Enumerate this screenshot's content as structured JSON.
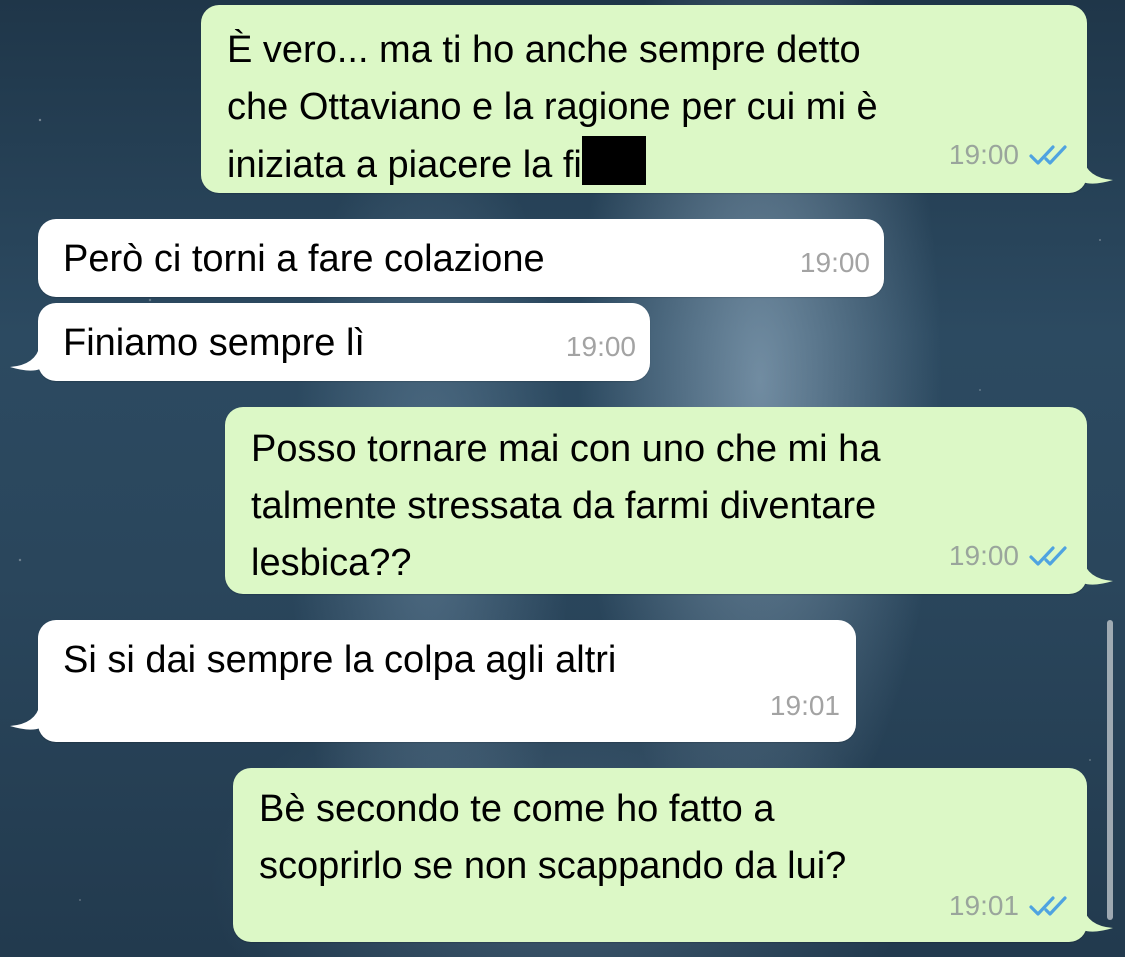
{
  "messages": [
    {
      "direction": "outgoing",
      "lines": [
        "È vero... ma ti ho anche sempre detto",
        "che Ottaviano e la ragione per cui mi è",
        "iniziata a piacere la fi"
      ],
      "time": "19:00",
      "status_icon": "double-check-read-icon"
    },
    {
      "direction": "incoming",
      "lines": [
        "Però ci torni a fare colazione"
      ],
      "time": "19:00"
    },
    {
      "direction": "incoming",
      "lines": [
        "Finiamo sempre lì"
      ],
      "time": "19:00"
    },
    {
      "direction": "outgoing",
      "lines": [
        "Posso tornare mai con uno che mi ha",
        "talmente stressata da farmi diventare",
        "lesbica??"
      ],
      "time": "19:00",
      "status_icon": "double-check-read-icon"
    },
    {
      "direction": "incoming",
      "lines": [
        "Si si dai sempre la colpa agli altri"
      ],
      "time": "19:01"
    },
    {
      "direction": "outgoing",
      "lines": [
        "Bè secondo te come ho fatto a",
        "scoprirlo se non scappando da lui?"
      ],
      "time": "19:01",
      "status_icon": "double-check-read-icon"
    }
  ],
  "colors": {
    "outgoing_bubble": "#dcf8c6",
    "incoming_bubble": "#ffffff",
    "read_ticks": "#4fa3e0"
  }
}
